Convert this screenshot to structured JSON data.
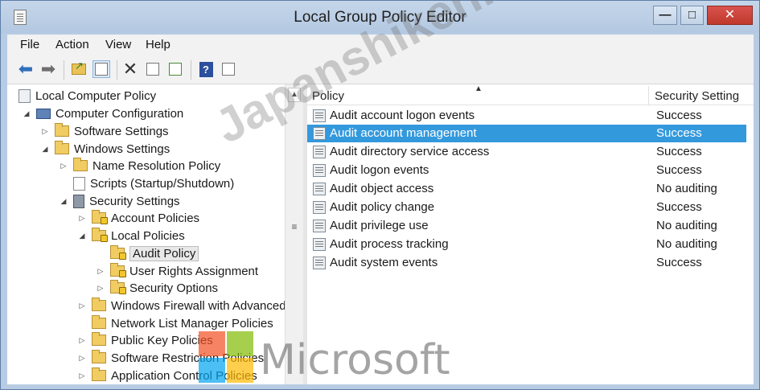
{
  "window": {
    "title": "Local Group Policy Editor",
    "minimize_icon": "minimize-icon",
    "maximize_icon": "maximize-icon",
    "close_icon": "close-icon"
  },
  "menu": [
    "File",
    "Action",
    "View",
    "Help"
  ],
  "toolbar": {
    "buttons": [
      "back-arrow-icon",
      "forward-arrow-icon",
      "up-folder-icon",
      "show-hide-tree-icon",
      "delete-icon",
      "properties-icon",
      "export-list-icon",
      "help-icon",
      "show-console-icon"
    ]
  },
  "tree": {
    "nodes": [
      {
        "label": "Local Computer Policy",
        "icon": "policy",
        "toggle": ""
      },
      {
        "label": "Computer Configuration",
        "icon": "computer",
        "toggle": "◢"
      },
      {
        "label": "Software Settings",
        "icon": "folder",
        "toggle": "▷"
      },
      {
        "label": "Windows Settings",
        "icon": "folder",
        "toggle": "◢"
      },
      {
        "label": "Name Resolution Policy",
        "icon": "folder",
        "toggle": "▷"
      },
      {
        "label": "Scripts (Startup/Shutdown)",
        "icon": "script",
        "toggle": ""
      },
      {
        "label": "Security Settings",
        "icon": "security",
        "toggle": "◢"
      },
      {
        "label": "Account Policies",
        "icon": "folder-lock",
        "toggle": "▷"
      },
      {
        "label": "Local Policies",
        "icon": "folder-lock",
        "toggle": "◢"
      },
      {
        "label": "Audit Policy",
        "icon": "folder-lock",
        "toggle": ""
      },
      {
        "label": "User Rights Assignment",
        "icon": "folder-lock",
        "toggle": "▷"
      },
      {
        "label": "Security Options",
        "icon": "folder-lock",
        "toggle": "▷"
      },
      {
        "label": "Windows Firewall with Advanced",
        "icon": "folder",
        "toggle": "▷"
      },
      {
        "label": "Network List Manager Policies",
        "icon": "folder",
        "toggle": ""
      },
      {
        "label": "Public Key Policies",
        "icon": "folder",
        "toggle": "▷"
      },
      {
        "label": "Software Restriction Policies",
        "icon": "folder",
        "toggle": "▷"
      },
      {
        "label": "Application Control Policies",
        "icon": "folder",
        "toggle": "▷"
      }
    ],
    "selected": "Audit Policy"
  },
  "list": {
    "columns": {
      "policy": "Policy",
      "setting": "Security Setting"
    },
    "rows": [
      {
        "policy": "Audit account logon events",
        "setting": "Success"
      },
      {
        "policy": "Audit account management",
        "setting": "Success"
      },
      {
        "policy": "Audit directory service access",
        "setting": "Success"
      },
      {
        "policy": "Audit logon events",
        "setting": "Success"
      },
      {
        "policy": "Audit object access",
        "setting": "No auditing"
      },
      {
        "policy": "Audit policy change",
        "setting": "Success"
      },
      {
        "policy": "Audit privilege use",
        "setting": "No auditing"
      },
      {
        "policy": "Audit process tracking",
        "setting": "No auditing"
      },
      {
        "policy": "Audit system events",
        "setting": "Success"
      }
    ],
    "selected_row": "Audit account management"
  },
  "watermark": {
    "site": "Japanshiken.com",
    "brand": "Microsoft",
    "logo_colors": [
      "#f25022",
      "#7fba00",
      "#00a4ef",
      "#ffb900"
    ]
  },
  "colors": {
    "selection": "#3399dd",
    "titlebar": "#b7cbe3",
    "close": "#c0392b"
  }
}
